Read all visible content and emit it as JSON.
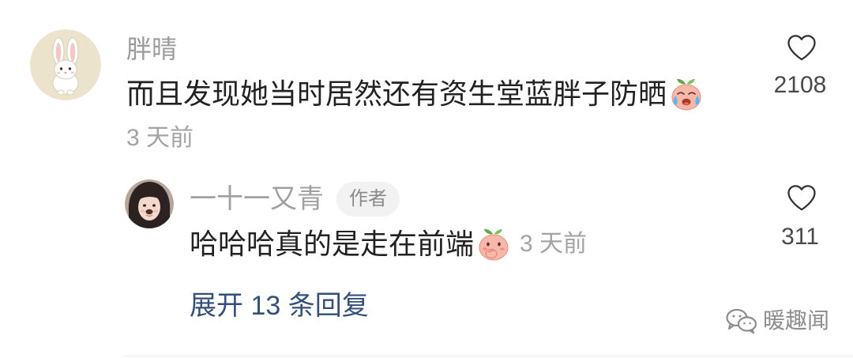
{
  "comment": {
    "username": "胖晴",
    "text": "而且发现她当时居然还有资生堂蓝胖子防晒",
    "emoji": "crying-peach-emoji",
    "time": "3 天前",
    "likes": "2108",
    "like_icon": "heart-outline-icon"
  },
  "reply": {
    "username": "一十一又青",
    "badge": "作者",
    "text": "哈哈哈真的是走在前端",
    "emoji": "covering-mouth-peach-emoji",
    "time": "3 天前",
    "likes": "311",
    "like_icon": "heart-outline-icon"
  },
  "expand_label": "展开 13 条回复",
  "watermark": {
    "icon": "wechat-icon",
    "text": "暖趣闻"
  },
  "colors": {
    "background": "#ffffff",
    "username": "#9b9b9b",
    "body_text": "#222222",
    "meta_text": "#a3a3a3",
    "link": "#34507a",
    "badge_bg": "#f2f2f2"
  }
}
